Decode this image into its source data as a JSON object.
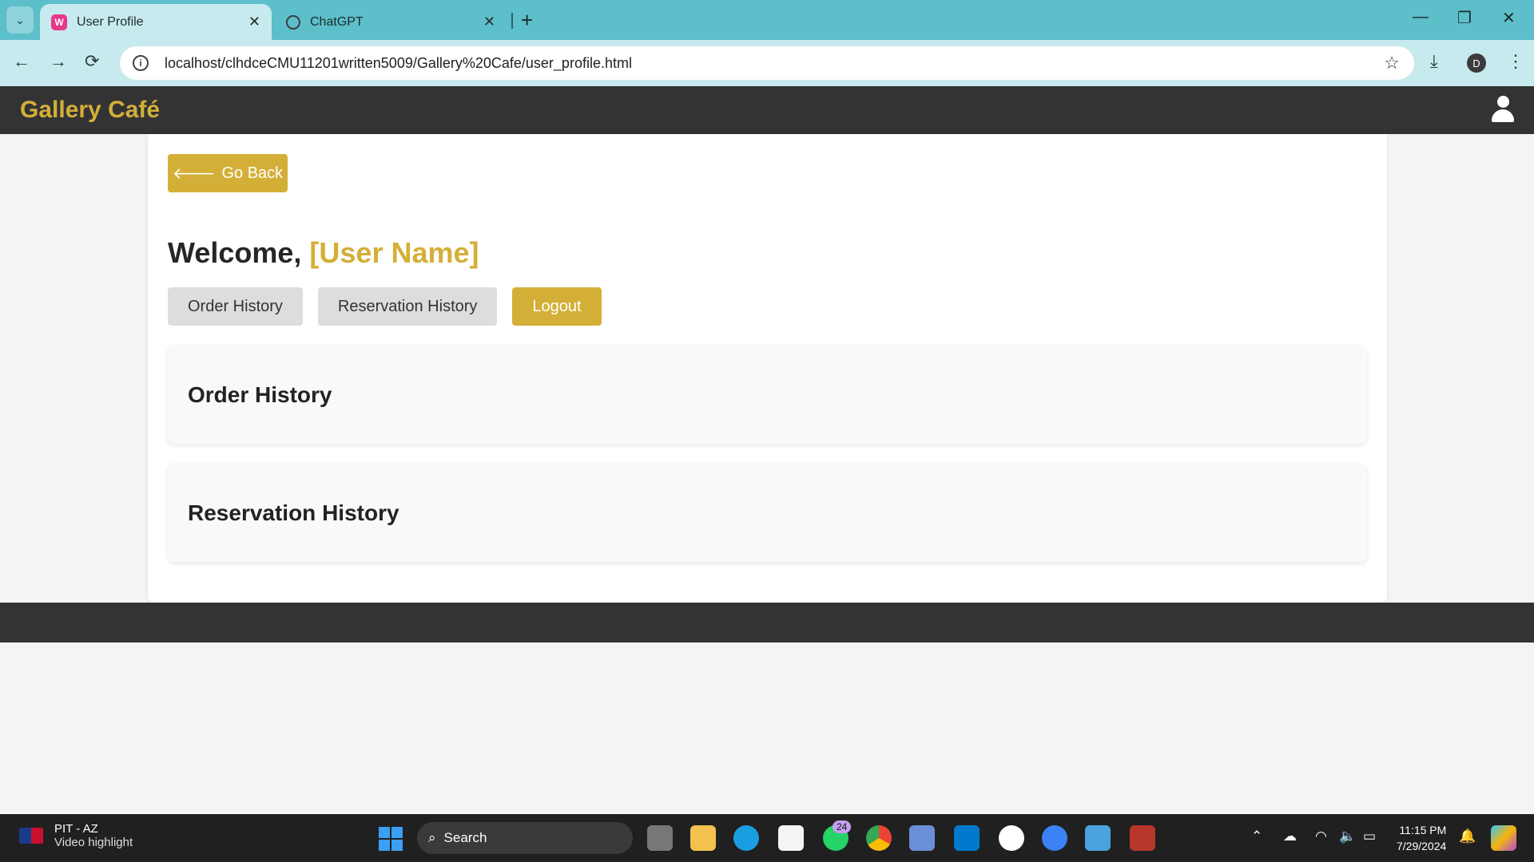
{
  "browser": {
    "tabs": [
      {
        "title": "User Profile",
        "favicon": "W"
      },
      {
        "title": "ChatGPT"
      }
    ],
    "url": "localhost/clhdceCMU11201written5009/Gallery%20Cafe/user_profile.html",
    "profile_initial": "D"
  },
  "site": {
    "brand": "Gallery Café",
    "go_back_label": "Go Back",
    "welcome_prefix": "Welcome,",
    "user_name": "[User Name]",
    "buttons": {
      "order_history": "Order History",
      "reservation_history": "Reservation History",
      "logout": "Logout"
    },
    "sections": {
      "order_history_title": "Order History",
      "reservation_history_title": "Reservation History"
    },
    "colors": {
      "accent": "#d4af37",
      "header": "#333333"
    }
  },
  "taskbar": {
    "news_title": "PIT - AZ",
    "news_sub": "Video highlight",
    "search_label": "Search",
    "whatsapp_badge": "24",
    "time": "11:15 PM",
    "date": "7/29/2024"
  }
}
